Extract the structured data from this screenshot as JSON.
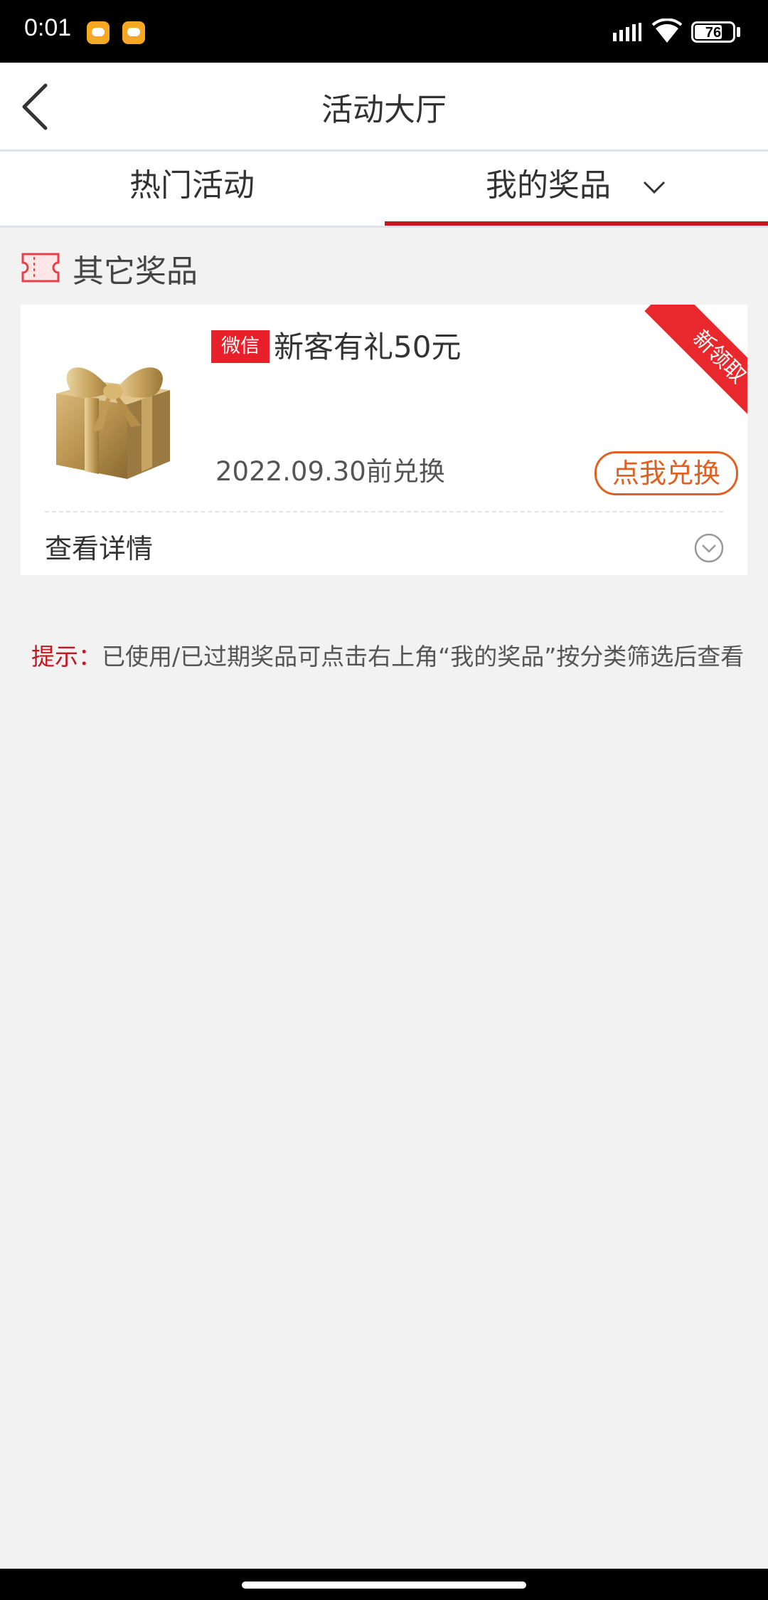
{
  "status_bar": {
    "time": "0:01",
    "battery": "76",
    "icons": [
      "notification-icon",
      "notification-icon",
      "signal-icon",
      "wifi-icon",
      "battery-icon"
    ]
  },
  "header": {
    "title": "活动大厅",
    "back_icon": "back-arrow-icon"
  },
  "tabs": [
    {
      "label": "热门活动",
      "active": false
    },
    {
      "label": "我的奖品",
      "active": true,
      "icon": "chevron-down-icon"
    }
  ],
  "section": {
    "title": "其它奖品",
    "icon": "ticket-icon"
  },
  "prize": {
    "tag": "微信",
    "name": "新客有礼50元",
    "expire": "2022.09.30前兑换",
    "redeem_label": "点我兑换",
    "ribbon": "新领取",
    "details_label": "查看详情",
    "image": "gift-box-icon"
  },
  "tip": {
    "label": "提示：",
    "text": "已使用/已过期奖品可点击右上角“我的奖品”按分类筛选后查看"
  },
  "colors": {
    "accent_red": "#c8161d",
    "tag_red": "#e8202a",
    "redeem_orange": "#e06020",
    "background": "#f2f2f2"
  }
}
